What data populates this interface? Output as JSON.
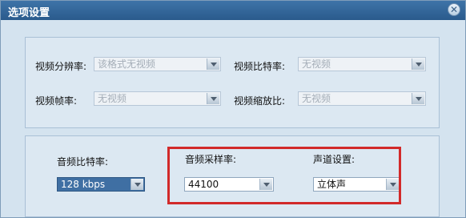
{
  "window": {
    "title": "选项设置"
  },
  "video": {
    "resolution": {
      "label": "视频分辨率:",
      "value": "该格式无视频"
    },
    "bitrate": {
      "label": "视频比特率:",
      "value": "无视频"
    },
    "framerate": {
      "label": "视频帧率:",
      "value": "无视频"
    },
    "scale": {
      "label": "视频缩放比:",
      "value": "无视频"
    }
  },
  "audio": {
    "bitrate": {
      "label": "音频比特率:",
      "value": "128 kbps"
    },
    "samplerate": {
      "label": "音频采样率:",
      "value": "44100"
    },
    "channel": {
      "label": "声道设置:",
      "value": "立体声"
    }
  },
  "colors": {
    "highlight": "#d22a2a",
    "titlebar": "#2a5a8c"
  }
}
